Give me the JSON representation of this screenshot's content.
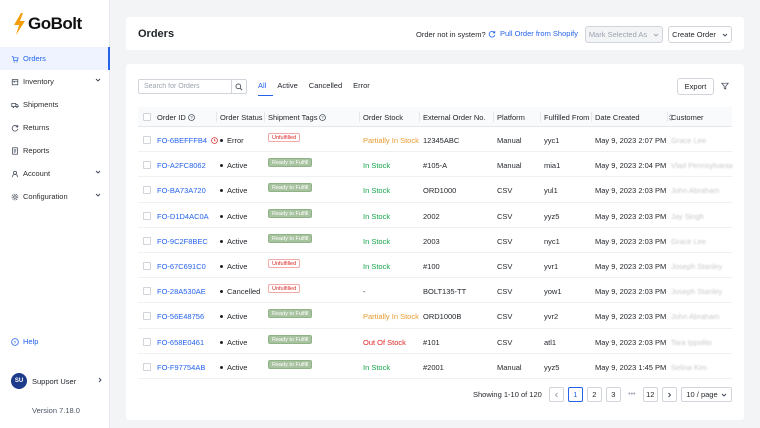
{
  "brand": {
    "name": "GoBolt",
    "accent": "#2563eb"
  },
  "sidebar": {
    "items": [
      {
        "label": "Orders",
        "icon": "cart-icon",
        "active": true
      },
      {
        "label": "Inventory",
        "icon": "box-icon",
        "expandable": true
      },
      {
        "label": "Shipments",
        "icon": "truck-icon"
      },
      {
        "label": "Returns",
        "icon": "returns-icon"
      },
      {
        "label": "Reports",
        "icon": "report-icon"
      },
      {
        "label": "Account",
        "icon": "account-icon",
        "expandable": true
      },
      {
        "label": "Configuration",
        "icon": "gear-icon",
        "expandable": true
      }
    ],
    "help": "Help",
    "user": {
      "initials": "SU",
      "name": "Support User"
    },
    "version": "Version 7.18.0"
  },
  "header": {
    "title": "Orders",
    "not_in_system": "Order not in system?",
    "pull_link": "Pull Order from Shopify",
    "mark_selected": "Mark Selected As",
    "create_order": "Create Order"
  },
  "toolbar": {
    "search_placeholder": "Search for Orders",
    "tabs": [
      "All",
      "Active",
      "Cancelled",
      "Error"
    ],
    "active_tab": "All",
    "export": "Export"
  },
  "table": {
    "columns": [
      "Order ID",
      "Order Status",
      "Shipment Tags",
      "Order Stock",
      "External Order No.",
      "Platform",
      "Fulfilled From",
      "Date Created",
      "Customer"
    ],
    "rows": [
      {
        "id": "FO-6BEFFFB4",
        "status": "Error",
        "tag": "Unfulfilled",
        "stock": "Partially In Stock",
        "external": "12345ABC",
        "platform": "Manual",
        "from": "yyc1",
        "date": "May 9, 2023 2:07 PM",
        "customer": "Grace Lee"
      },
      {
        "id": "FO-A2FC8062",
        "status": "Active",
        "tag": "Ready to Fulfill",
        "stock": "In Stock",
        "external": "#105-A",
        "platform": "Manual",
        "from": "mia1",
        "date": "May 9, 2023 2:04 PM",
        "customer": "Vlad Pennsylvania"
      },
      {
        "id": "FO-BA73A720",
        "status": "Active",
        "tag": "Ready to Fulfill",
        "stock": "In Stock",
        "external": "ORD1000",
        "platform": "CSV",
        "from": "yul1",
        "date": "May 9, 2023 2:03 PM",
        "customer": "John Abraham"
      },
      {
        "id": "FO-D1D4AC0A",
        "status": "Active",
        "tag": "Ready to Fulfill",
        "stock": "In Stock",
        "external": "2002",
        "platform": "CSV",
        "from": "yyz5",
        "date": "May 9, 2023 2:03 PM",
        "customer": "Jay Singh"
      },
      {
        "id": "FO-9C2F8BEC",
        "status": "Active",
        "tag": "Ready to Fulfill",
        "stock": "In Stock",
        "external": "2003",
        "platform": "CSV",
        "from": "nyc1",
        "date": "May 9, 2023 2:03 PM",
        "customer": "Grace Lee"
      },
      {
        "id": "FO-67C691C0",
        "status": "Active",
        "tag": "Unfulfilled",
        "stock": "In Stock",
        "external": "#100",
        "platform": "CSV",
        "from": "yvr1",
        "date": "May 9, 2023 2:03 PM",
        "customer": "Joseph Stanley"
      },
      {
        "id": "FO-28A530AE",
        "status": "Cancelled",
        "tag": "Unfulfilled",
        "stock": "-",
        "external": "BOLT135-TT",
        "platform": "CSV",
        "from": "yow1",
        "date": "May 9, 2023 2:03 PM",
        "customer": "Joseph Stanley"
      },
      {
        "id": "FO-56E48756",
        "status": "Active",
        "tag": "Ready to Fulfill",
        "stock": "Partially In Stock",
        "external": "ORD1000B",
        "platform": "CSV",
        "from": "yvr2",
        "date": "May 9, 2023 2:03 PM",
        "customer": "John Abraham"
      },
      {
        "id": "FO-658E0461",
        "status": "Active",
        "tag": "Ready to Fulfill",
        "stock": "Out Of Stock",
        "external": "#101",
        "platform": "CSV",
        "from": "atl1",
        "date": "May 9, 2023 2:03 PM",
        "customer": "Tara Ippolito"
      },
      {
        "id": "FO-F97754AB",
        "status": "Active",
        "tag": "Ready to Fulfill",
        "stock": "In Stock",
        "external": "#2001",
        "platform": "Manual",
        "from": "yyz5",
        "date": "May 9, 2023 1:45 PM",
        "customer": "Selina Kim"
      }
    ]
  },
  "pagination": {
    "showing": "Showing 1-10 of 120",
    "pages": [
      "1",
      "2",
      "3"
    ],
    "ellipsis": "•••",
    "last": "12",
    "page_size": "10 / page"
  }
}
